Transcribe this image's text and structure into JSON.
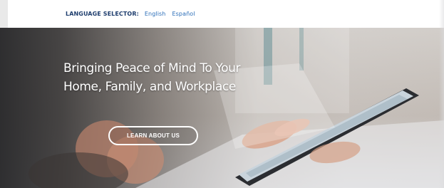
{
  "language_bar": {
    "label": "LANGUAGE SELECTOR:",
    "options": [
      "English",
      "Español"
    ]
  },
  "hero": {
    "title_lines": [
      "Bringing Peace of Mind To Your",
      "Home, Family, and Workplace"
    ],
    "button_label": "LEARN ABOUT US"
  },
  "colors": {
    "label_navy": "#1f3e6e",
    "link_blue": "#2a6db8",
    "hero_text": "#ffffff"
  },
  "icons": [
    "hero-photo-illustration"
  ]
}
